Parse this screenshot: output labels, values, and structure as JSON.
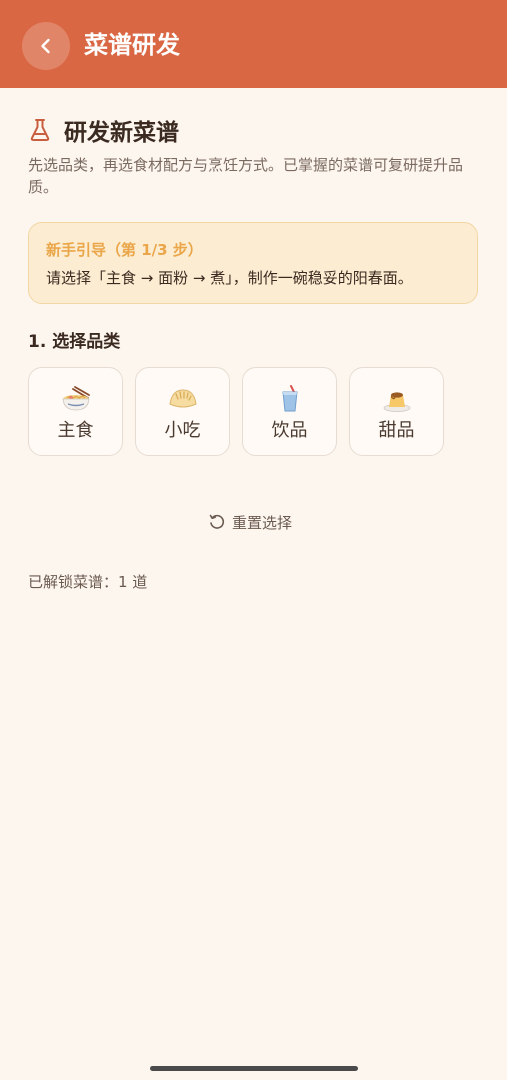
{
  "appbar": {
    "title": "菜谱研发"
  },
  "heading": {
    "title": "研发新菜谱",
    "description": "先选品类，再选食材配方与烹饪方式。已掌握的菜谱可复研提升品质。"
  },
  "guide": {
    "title": "新手引导（第 1/3 步）",
    "text": "请选择「主食 → 面粉 → 煮」，制作一碗稳妥的阳春面。",
    "step_current": 1,
    "step_total": 3
  },
  "section": {
    "title": "1. 选择品类"
  },
  "categories": [
    {
      "label": "主食",
      "icon": "noodle-bowl-icon"
    },
    {
      "label": "小吃",
      "icon": "dumpling-icon"
    },
    {
      "label": "饮品",
      "icon": "drink-cup-icon"
    },
    {
      "label": "甜品",
      "icon": "pudding-icon"
    }
  ],
  "reset": {
    "label": "重置选择",
    "icon": "reset-icon"
  },
  "unlocked": {
    "text": "已解锁菜谱：1 道"
  },
  "colors": {
    "header_bg": "#da6744",
    "page_bg": "#fdf6ef",
    "guide_bg": "#fcecd2",
    "guide_title": "#eaa649",
    "accent_icon": "#c95f3f"
  }
}
